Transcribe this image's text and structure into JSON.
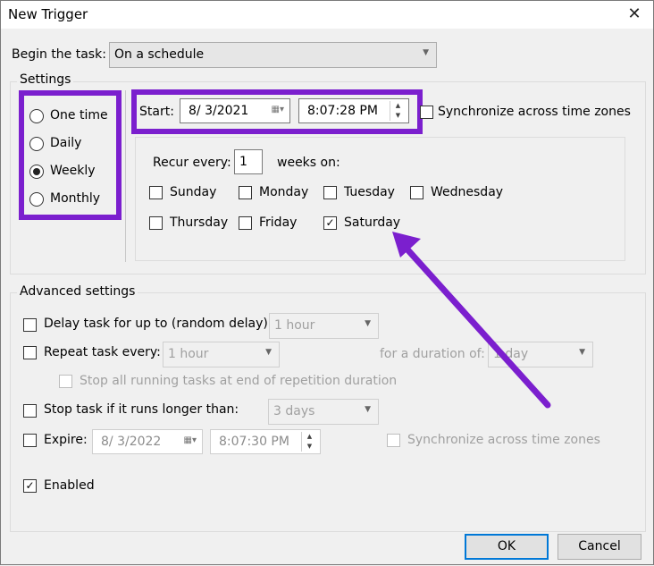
{
  "window": {
    "title": "New Trigger"
  },
  "begin": {
    "label": "Begin the task:",
    "value": "On a schedule"
  },
  "settings": {
    "title": "Settings",
    "schedules": [
      {
        "label": "One time",
        "selected": false
      },
      {
        "label": "Daily",
        "selected": false
      },
      {
        "label": "Weekly",
        "selected": true
      },
      {
        "label": "Monthly",
        "selected": false
      }
    ],
    "start_label": "Start:",
    "start_date": "8/  3/2021",
    "start_time": "8:07:28 PM",
    "sync_label": "Synchronize across time zones",
    "sync_checked": false,
    "recur_label": "Recur every:",
    "recur_value": "1",
    "recur_unit": "weeks on:",
    "days": [
      {
        "label": "Sunday",
        "checked": false
      },
      {
        "label": "Monday",
        "checked": false
      },
      {
        "label": "Tuesday",
        "checked": false
      },
      {
        "label": "Wednesday",
        "checked": false
      },
      {
        "label": "Thursday",
        "checked": false
      },
      {
        "label": "Friday",
        "checked": false
      },
      {
        "label": "Saturday",
        "checked": true
      }
    ]
  },
  "advanced": {
    "title": "Advanced settings",
    "delay_label": "Delay task for up to (random delay):",
    "delay_value": "1 hour",
    "repeat_label": "Repeat task every:",
    "repeat_value": "1 hour",
    "duration_label": "for a duration of:",
    "duration_value": "1 day",
    "stop_running_label": "Stop all running tasks at end of repetition duration",
    "stop_longer_label": "Stop task if it runs longer than:",
    "stop_longer_value": "3 days",
    "expire_label": "Expire:",
    "expire_date": "8/  3/2022",
    "expire_time": "8:07:30 PM",
    "expire_sync_label": "Synchronize across time zones",
    "enabled_label": "Enabled",
    "enabled_checked": true
  },
  "buttons": {
    "ok": "OK",
    "cancel": "Cancel"
  },
  "colors": {
    "highlight": "#7b1fce",
    "accent": "#0078d7"
  },
  "icons": {
    "close": "close-icon",
    "dropdown": "chevron-down-icon",
    "calendar": "calendar-icon"
  }
}
